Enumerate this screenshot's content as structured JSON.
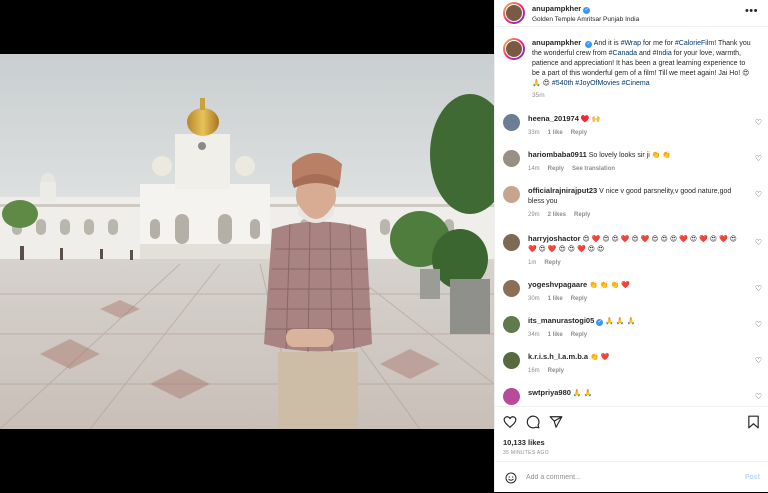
{
  "post": {
    "username": "anupampkher",
    "location": "Golden Temple Amritsar Punjab India",
    "more_icon": "more-horizontal-icon",
    "caption_parts": [
      {
        "t": "And it is ",
        "tag": false
      },
      {
        "t": "#Wrap",
        "tag": true
      },
      {
        "t": " for me for ",
        "tag": false
      },
      {
        "t": "#CalorieFilm",
        "tag": true
      },
      {
        "t": "! Thank you the wonderful crew from ",
        "tag": false
      },
      {
        "t": "#Canada",
        "tag": true
      },
      {
        "t": " and ",
        "tag": false
      },
      {
        "t": "#India",
        "tag": true
      },
      {
        "t": " for your love, warmth, patience and appreciation! It has been a great learning experience to be a part of this wonderful gem of a film! Till we meet again! Jai Ho! 😍 🙏 😍 ",
        "tag": false
      },
      {
        "t": "#540th",
        "tag": true
      },
      {
        "t": " ",
        "tag": false
      },
      {
        "t": "#JoyOfMovies",
        "tag": true
      },
      {
        "t": " ",
        "tag": false
      },
      {
        "t": "#Cinema",
        "tag": true
      }
    ],
    "caption_time": "35m"
  },
  "comments": [
    {
      "user": "heena_201974",
      "text": "♥️ 🙌",
      "time": "33m",
      "likes": "1 like",
      "reply": "Reply",
      "extra": "",
      "color": "#6a7f93",
      "verified": false
    },
    {
      "user": "hariombaba0911",
      "text": "So lovely looks sir ji 👏 👏",
      "time": "14m",
      "likes": "",
      "reply": "Reply",
      "extra": "See translation",
      "color": "#9a8f84",
      "verified": false
    },
    {
      "user": "officialrajnirajput23",
      "text": "V nice v good parsnelity,v good nature,god bless you",
      "time": "29m",
      "likes": "2 likes",
      "reply": "Reply",
      "extra": "",
      "color": "#c7a48e",
      "verified": false
    },
    {
      "user": "harryjoshactor",
      "text": "😍 ❤️ 😍 😍 ❤️ 😍 ❤️ 😍 😍 😍 ❤️ 😍 ❤️ 😍 ❤️ 😍 ❤️ 😍 ❤️ 😍 😍 ❤️ 😍 😍",
      "time": "1m",
      "likes": "",
      "reply": "Reply",
      "extra": "",
      "color": "#7b6a54",
      "verified": false
    },
    {
      "user": "yogeshvpagaare",
      "text": "👏 👏 👏 ❤️",
      "time": "30m",
      "likes": "1 like",
      "reply": "Reply",
      "extra": "",
      "color": "#8a6f55",
      "verified": false
    },
    {
      "user": "its_manurastogi05",
      "text": "🙏 🙏 🙏",
      "time": "34m",
      "likes": "1 like",
      "reply": "Reply",
      "extra": "",
      "color": "#5f7a4d",
      "verified": true
    },
    {
      "user": "k.r.i.s.h_l.a.m.b.a",
      "text": "👏 ❤️",
      "time": "16m",
      "likes": "",
      "reply": "Reply",
      "extra": "",
      "color": "#556b3f",
      "verified": false
    },
    {
      "user": "swtpriya980",
      "text": "🙏 🙏",
      "time": "",
      "likes": "",
      "reply": "",
      "extra": "",
      "color": "#b84a9a",
      "verified": false
    }
  ],
  "actions": {
    "like_icon": "heart-icon",
    "comment_icon": "comment-icon",
    "share_icon": "share-icon",
    "save_icon": "bookmark-icon",
    "likes_count": "10,133 likes",
    "time_ago": "35 MINUTES AGO"
  },
  "add_comment": {
    "placeholder": "Add a comment...",
    "post_label": "Post",
    "emoji_icon": "smiley-icon"
  }
}
